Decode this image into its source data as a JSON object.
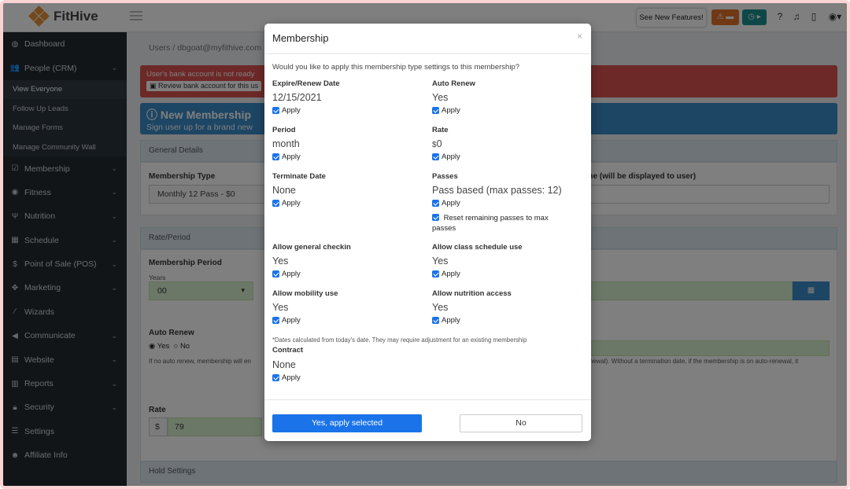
{
  "app": {
    "name": "FitHive",
    "features_button": "See New Features!",
    "alert_icon": "warning-card-icon",
    "teal_icon": "clock-play-icon"
  },
  "sidebar": {
    "items": [
      {
        "label": "Dashboard",
        "icon": "dashboard-icon",
        "chevron": false
      },
      {
        "label": "People (CRM)",
        "icon": "users-icon",
        "chevron": true
      },
      {
        "label": "Membership",
        "icon": "check-square-icon",
        "chevron": true
      },
      {
        "label": "Fitness",
        "icon": "fitness-icon",
        "chevron": true
      },
      {
        "label": "Nutrition",
        "icon": "utensils-icon",
        "chevron": true
      },
      {
        "label": "Schedule",
        "icon": "calendar-icon",
        "chevron": true
      },
      {
        "label": "Point of Sale (POS)",
        "icon": "dollar-icon",
        "chevron": true
      },
      {
        "label": "Marketing",
        "icon": "marketing-icon",
        "chevron": true
      },
      {
        "label": "Wizards",
        "icon": "wand-icon",
        "chevron": false
      },
      {
        "label": "Communicate",
        "icon": "megaphone-icon",
        "chevron": true
      },
      {
        "label": "Website",
        "icon": "website-icon",
        "chevron": true
      },
      {
        "label": "Reports",
        "icon": "chart-icon",
        "chevron": true
      },
      {
        "label": "Security",
        "icon": "lock-icon",
        "chevron": true
      },
      {
        "label": "Settings",
        "icon": "sliders-icon",
        "chevron": false
      },
      {
        "label": "Affiliate Info",
        "icon": "user-plus-icon",
        "chevron": false
      }
    ],
    "subitems": [
      "View Everyone",
      "Follow Up Leads",
      "Manage Forms",
      "Manage Community Wall"
    ]
  },
  "main": {
    "breadcrumb_root": "Users",
    "breadcrumb_sep": "/",
    "breadcrumb_user": "dbgoat@myfithive.com",
    "bank_alert": "User's bank account is not ready",
    "bank_alert_button": "Review bank account for this us",
    "new_membership_title": "New Membership",
    "new_membership_sub": "Sign user up for a brand new",
    "general_details": "General Details",
    "membership_type_label": "Membership Type",
    "membership_type_value": "Monthly 12 Pass - $0",
    "display_name_label": "ame (will be displayed to user)",
    "rate_period": "Rate/Period",
    "membership_period_label": "Membership Period",
    "years_label": "Years",
    "years_value": "00",
    "auto_renew_label": "Auto Renew",
    "auto_renew_yes": "Yes",
    "auto_renew_no": "No",
    "auto_renew_help_left": "If no auto renew, membership will en",
    "auto_renew_help_right": "-renewal). Without a termination date, if the membership is on auto-renewal, it",
    "rate_label": "Rate",
    "rate_currency": "$",
    "rate_value": "79",
    "hold_settings": "Hold Settings"
  },
  "modal": {
    "title": "Membership",
    "close": "×",
    "question": "Would you like to apply this membership type settings to this membership?",
    "apply": "Apply",
    "fields": {
      "expire_label": "Expire/Renew Date",
      "expire_value": "12/15/2021",
      "auto_renew_label": "Auto Renew",
      "auto_renew_value": "Yes",
      "period_label": "Period",
      "period_value": "month",
      "rate_label": "Rate",
      "rate_currency": "$",
      "rate_value": "0",
      "terminate_label": "Terminate Date",
      "terminate_value": "None",
      "passes_label": "Passes",
      "passes_value": "Pass based (max passes: 12)",
      "reset_passes": "Reset remaining passes to max passes",
      "general_checkin_label": "Allow general checkin",
      "general_checkin_value": "Yes",
      "class_schedule_label": "Allow class schedule use",
      "class_schedule_value": "Yes",
      "mobility_label": "Allow mobility use",
      "mobility_value": "Yes",
      "nutrition_label": "Allow nutrition access",
      "nutrition_value": "Yes",
      "contract_label": "Contract",
      "contract_value": "None"
    },
    "note": "*Dates calculated from today's date. They may require adjustment for an existing membership",
    "yes_button": "Yes, apply selected",
    "no_button": "No"
  }
}
